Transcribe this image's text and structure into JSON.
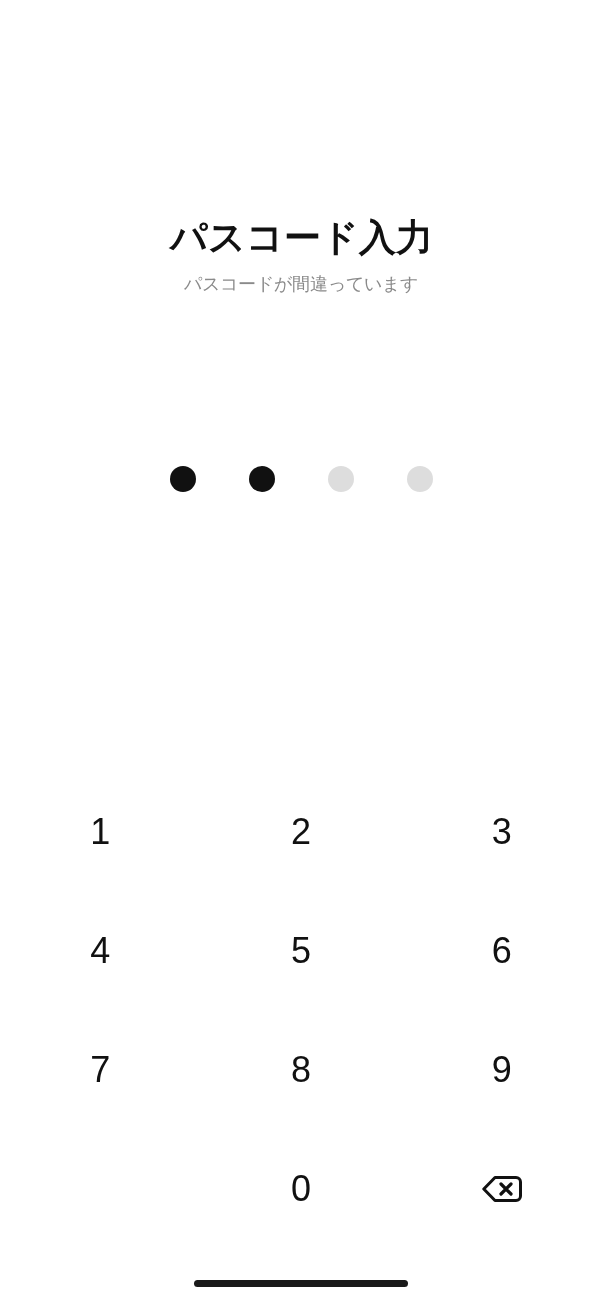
{
  "title": "パスコード入力",
  "message": "パスコードが間違っています",
  "passcode_dots": [
    {
      "filled": true
    },
    {
      "filled": true
    },
    {
      "filled": false
    },
    {
      "filled": false
    }
  ],
  "keypad": [
    {
      "kind": "digit",
      "label": "1"
    },
    {
      "kind": "digit",
      "label": "2"
    },
    {
      "kind": "digit",
      "label": "3"
    },
    {
      "kind": "digit",
      "label": "4"
    },
    {
      "kind": "digit",
      "label": "5"
    },
    {
      "kind": "digit",
      "label": "6"
    },
    {
      "kind": "digit",
      "label": "7"
    },
    {
      "kind": "digit",
      "label": "8"
    },
    {
      "kind": "digit",
      "label": "9"
    },
    {
      "kind": "spacer"
    },
    {
      "kind": "digit",
      "label": "0"
    },
    {
      "kind": "delete"
    }
  ]
}
